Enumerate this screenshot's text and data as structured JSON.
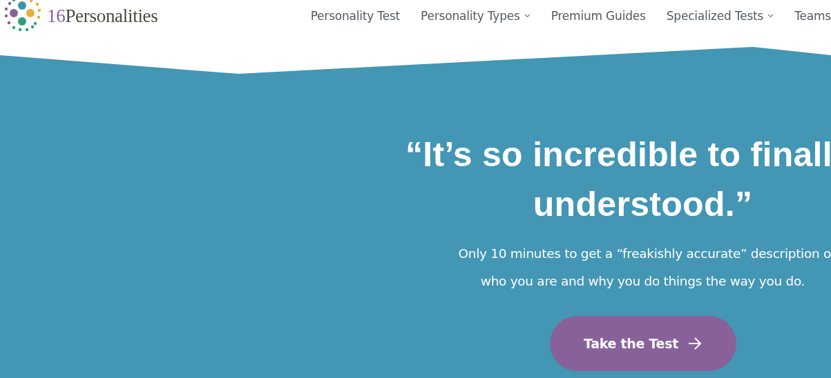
{
  "header": {
    "logo": {
      "number": "16",
      "name": "Personalities"
    },
    "nav": [
      {
        "label": "Personality Test",
        "dropdown": false
      },
      {
        "label": "Personality Types",
        "dropdown": true
      },
      {
        "label": "Premium Guides",
        "dropdown": false
      },
      {
        "label": "Specialized Tests",
        "dropdown": true
      },
      {
        "label": "Teams",
        "dropdown": false
      }
    ]
  },
  "hero": {
    "headline": [
      "“It’s so incredible to finall",
      "understood.”"
    ],
    "subtitle": [
      "Only 10 minutes to get a “freakishly accurate” description o",
      "who you are and why you do things the way you do."
    ],
    "button": "Take the Test"
  }
}
